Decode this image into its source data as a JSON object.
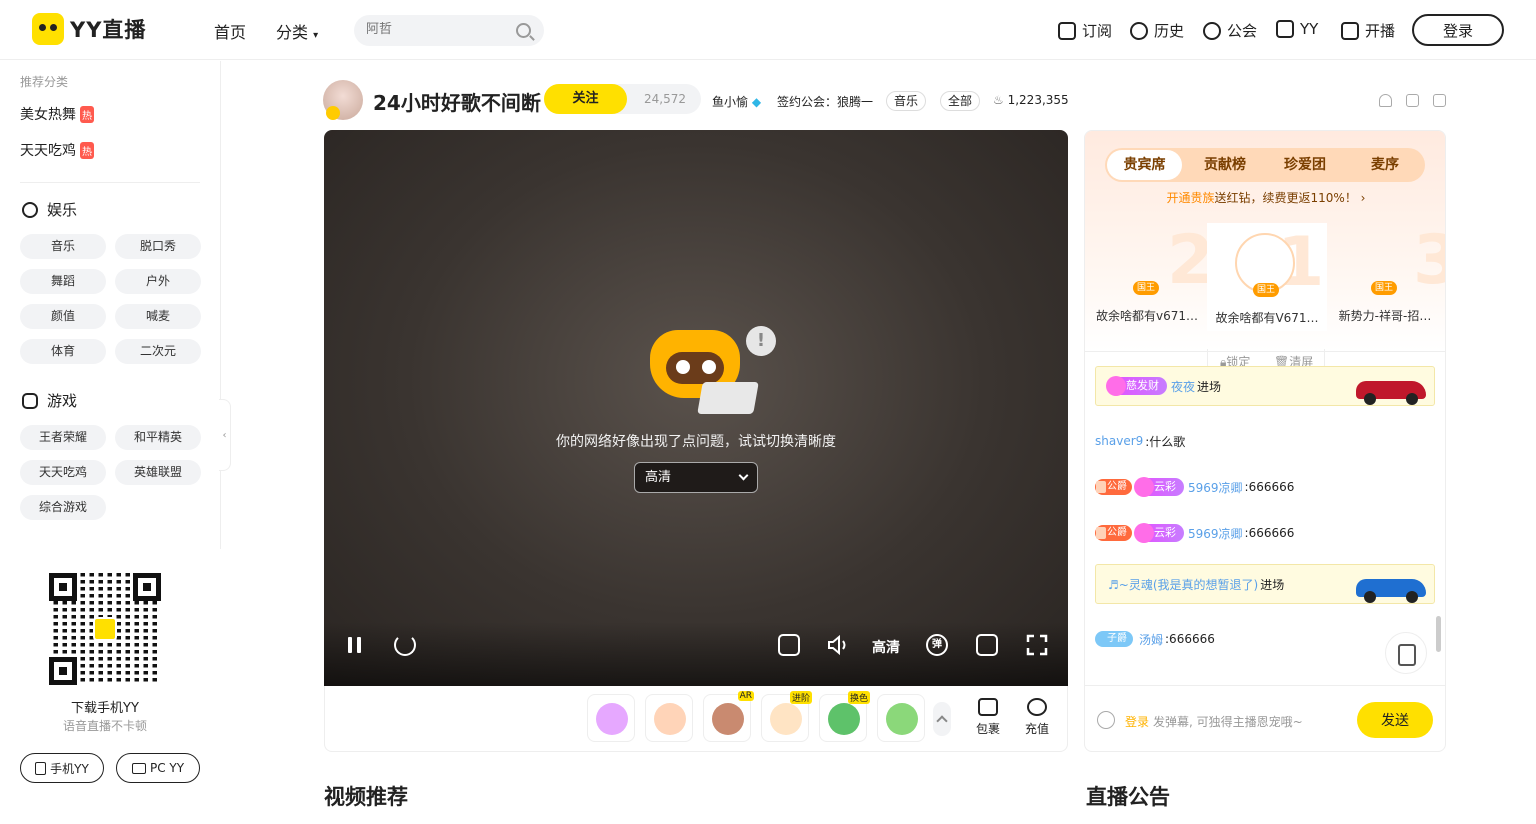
{
  "header": {
    "logo_text": "YY直播",
    "nav": [
      "首页",
      "分类"
    ],
    "search_placeholder": "阿哲",
    "tools": [
      "订阅",
      "历史",
      "公会",
      "YY",
      "开播"
    ],
    "login": "登录"
  },
  "sidebar": {
    "recommend_label": "推荐分类",
    "hot_items": [
      "美女热舞",
      "天天吃鸡"
    ],
    "hot_badge": "热",
    "entertainment": {
      "title": "娱乐",
      "items": [
        "音乐",
        "脱口秀",
        "舞蹈",
        "户外",
        "颜值",
        "喊麦",
        "体育",
        "二次元"
      ]
    },
    "games": {
      "title": "游戏",
      "items": [
        "王者荣耀",
        "和平精英",
        "天天吃鸡",
        "英雄联盟",
        "综合游戏"
      ]
    },
    "qr_text": "下载手机YY",
    "qr_sub": "语音直播不卡顿",
    "downloads": [
      "手机YY",
      "PC YY"
    ]
  },
  "room": {
    "title": "24小时好歌不间断",
    "follow_label": "关注",
    "follow_count": "24,572",
    "host": "鱼小愉",
    "guild": "签约公会：狼腾一",
    "tags": [
      "音乐",
      "全部"
    ],
    "heat": "1,223,355"
  },
  "player": {
    "error_text": "你的网络好像出现了点问题，试试切换清晰度",
    "quality_selected": "高清",
    "quality_label": "高清",
    "danmu_icon_text": "弹"
  },
  "gifts": {
    "items": [
      {
        "name": "gift-1",
        "color": "#e6a8ff",
        "tag": ""
      },
      {
        "name": "gift-2",
        "color": "#ffd4b8",
        "tag": ""
      },
      {
        "name": "gift-3",
        "color": "#c98a70",
        "tag": "AR"
      },
      {
        "name": "gift-4",
        "color": "#ffe4c4",
        "tag": "进阶"
      },
      {
        "name": "gift-5",
        "color": "#5ec26a",
        "tag": "换色"
      },
      {
        "name": "gift-6",
        "color": "#8bd87a",
        "tag": ""
      }
    ],
    "bag_label": "包裹",
    "recharge_label": "充值"
  },
  "panel": {
    "tabs": [
      "贵宾席",
      "贡献榜",
      "珍爱团",
      "麦序"
    ],
    "noble_highlight": "开通贵族",
    "noble_text": "送红钻，续费更返110%！",
    "ranks": [
      {
        "num": "2",
        "name": "故余啥都有v671…",
        "crown": "国王"
      },
      {
        "num": "1",
        "name": "故余啥都有V671…",
        "crown": "国王"
      },
      {
        "num": "3",
        "name": "新势力-祥哥-招…",
        "crown": "国王"
      }
    ],
    "lock_label": "锁定",
    "clear_label": "清屏",
    "messages": [
      {
        "type": "enter",
        "badge": "慈发财",
        "user": "夜夜",
        "text": "进场",
        "car_color": "#c0182b"
      },
      {
        "type": "chat",
        "user": "shaver9",
        "text": ":什么歌"
      },
      {
        "type": "chat",
        "guild": "公爵",
        "badge": "云彩",
        "user": "5969凉卿",
        "text": ":666666"
      },
      {
        "type": "chat",
        "guild": "公爵",
        "badge": "云彩",
        "user": "5969凉卿",
        "text": ":666666"
      },
      {
        "type": "enter",
        "user": "♬~灵魂(我是真的想暂退了)",
        "text": "进场",
        "car_color": "#1f6fd1"
      },
      {
        "type": "chat",
        "zbadge": "子爵",
        "user": "汤姆",
        "text": ":666666"
      }
    ],
    "input_login": "登录",
    "input_placeholder": "发弹幕, 可独得主播恩宠哦~",
    "send_label": "发送"
  },
  "sections": {
    "video_rec": "视频推荐",
    "announce": "直播公告"
  },
  "colors": {
    "brand": "#ffe000",
    "hot": "#ff5a4e",
    "link": "#5aa0e8"
  }
}
